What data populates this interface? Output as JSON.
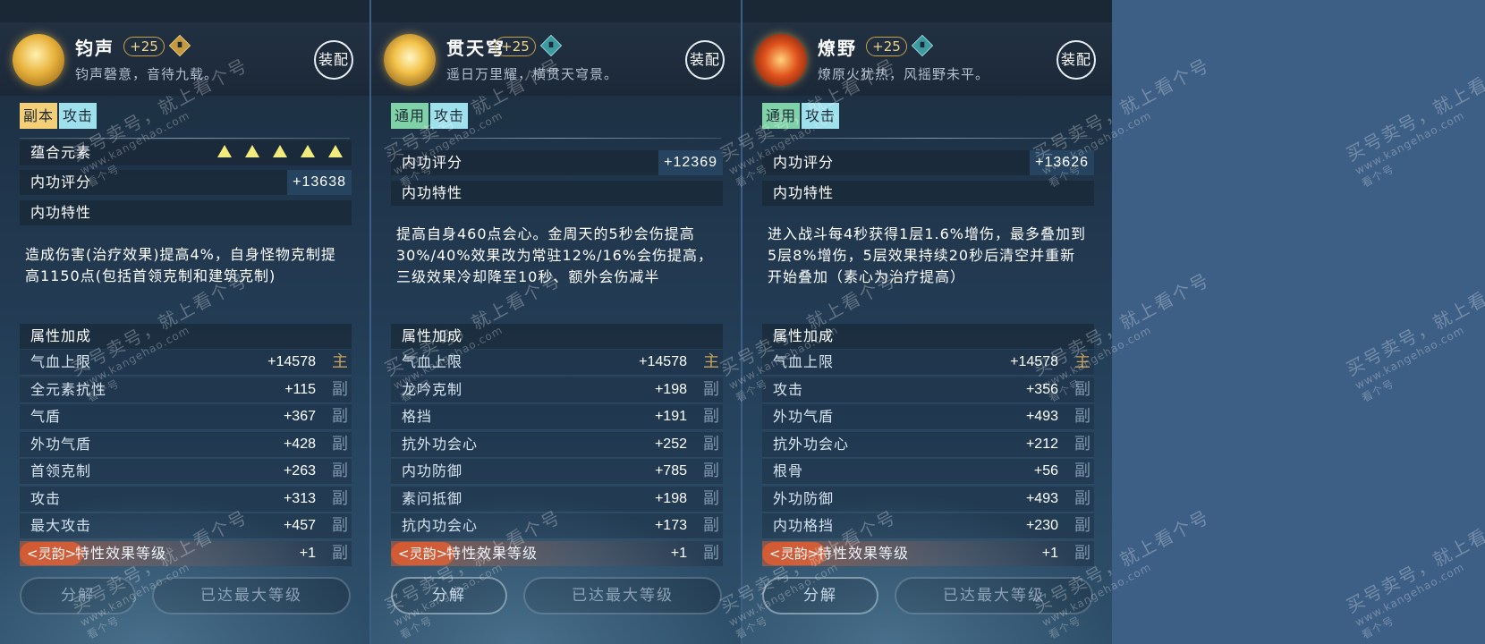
{
  "cards": [
    {
      "name": "钧声",
      "level": "+25",
      "motto": "钧声磬意，音待九载。",
      "equip_label": "装配",
      "tags": [
        "副本",
        "攻击"
      ],
      "element_row_label": "蕴合元素",
      "score_label": "内功评分",
      "score_value": "+13638",
      "trait_heading": "内功特性",
      "trait_desc": "造成伤害(治疗效果)提高4%，自身怪物克制提高1150点(包括首领克制和建筑克制)",
      "attr_heading": "属性加成",
      "stats": [
        {
          "label": "气血上限",
          "value": "+14578",
          "src": "主"
        },
        {
          "label": "全元素抗性",
          "value": "+115",
          "src": "副"
        },
        {
          "label": "气盾",
          "value": "+367",
          "src": "副"
        },
        {
          "label": "外功气盾",
          "value": "+428",
          "src": "副"
        },
        {
          "label": "首领克制",
          "value": "+263",
          "src": "副"
        },
        {
          "label": "攻击",
          "value": "+313",
          "src": "副"
        },
        {
          "label": "最大攻击",
          "value": "+457",
          "src": "副"
        }
      ],
      "charm_tag": "<灵韵>",
      "charm_label": "特性效果等级",
      "charm_value": "+1",
      "charm_src": "副",
      "dismantle_label": "分解",
      "max_level_label": "已达最大等级"
    },
    {
      "name": "贯天穹",
      "level": "+25",
      "motto": "遥日万里耀，横贯天穹景。",
      "equip_label": "装配",
      "tags": [
        "通用",
        "攻击"
      ],
      "score_label": "内功评分",
      "score_value": "+12369",
      "trait_heading": "内功特性",
      "trait_desc": "提高自身460点会心。金周天的5秒会伤提高30%/40%效果改为常驻12%/16%会伤提高，三级效果冷却降至10秒、额外会伤减半",
      "attr_heading": "属性加成",
      "stats": [
        {
          "label": "气血上限",
          "value": "+14578",
          "src": "主"
        },
        {
          "label": "龙吟克制",
          "value": "+198",
          "src": "副"
        },
        {
          "label": "格挡",
          "value": "+191",
          "src": "副"
        },
        {
          "label": "抗外功会心",
          "value": "+252",
          "src": "副"
        },
        {
          "label": "内功防御",
          "value": "+785",
          "src": "副"
        },
        {
          "label": "素问抵御",
          "value": "+198",
          "src": "副"
        },
        {
          "label": "抗内功会心",
          "value": "+173",
          "src": "副"
        }
      ],
      "charm_tag": "<灵韵>",
      "charm_label": "特性效果等级",
      "charm_value": "+1",
      "charm_src": "副",
      "dismantle_label": "分解",
      "max_level_label": "已达最大等级"
    },
    {
      "name": "燎野",
      "level": "+25",
      "motto": "燎原火犹热，风摇野未平。",
      "equip_label": "装配",
      "tags": [
        "通用",
        "攻击"
      ],
      "score_label": "内功评分",
      "score_value": "+13626",
      "trait_heading": "内功特性",
      "trait_desc": "进入战斗每4秒获得1层1.6%增伤，最多叠加到5层8%增伤，5层效果持续20秒后清空并重新开始叠加（素心为治疗提高）",
      "attr_heading": "属性加成",
      "stats": [
        {
          "label": "气血上限",
          "value": "+14578",
          "src": "主"
        },
        {
          "label": "攻击",
          "value": "+356",
          "src": "副"
        },
        {
          "label": "外功气盾",
          "value": "+493",
          "src": "副"
        },
        {
          "label": "抗外功会心",
          "value": "+212",
          "src": "副"
        },
        {
          "label": "根骨",
          "value": "+56",
          "src": "副"
        },
        {
          "label": "外功防御",
          "value": "+493",
          "src": "副"
        },
        {
          "label": "内功格挡",
          "value": "+230",
          "src": "副"
        }
      ],
      "charm_tag": "<灵韵>",
      "charm_label": "特性效果等级",
      "charm_value": "+1",
      "charm_src": "副",
      "dismantle_label": "分解",
      "max_level_label": "已达最大等级"
    }
  ],
  "watermark": {
    "text": "买号卖号，就上看个号",
    "url": "www.kangehao.com",
    "badge": "看个号"
  },
  "colors": {
    "background": "#3d5f86",
    "tag_orange": "#f5cf77",
    "tag_green": "#7fd1a7",
    "tag_blue": "#9ee0ec",
    "highlight": "#e3a650",
    "charm": "#d8562a"
  }
}
